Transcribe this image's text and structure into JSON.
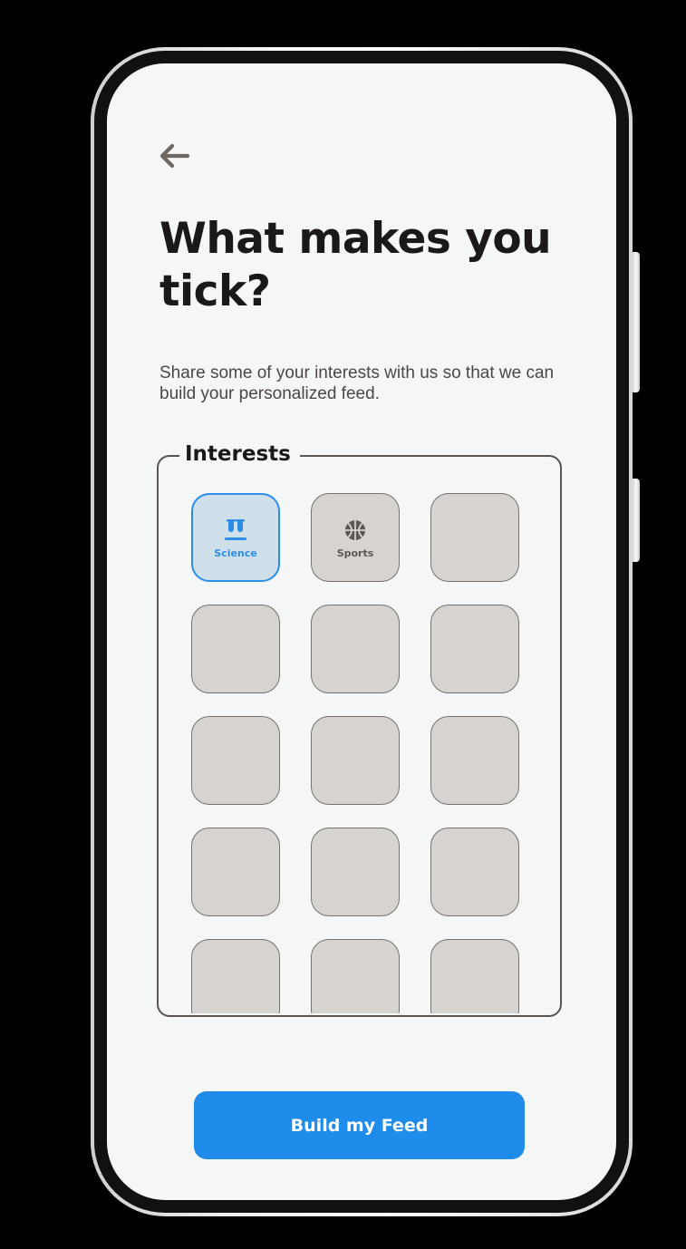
{
  "header": {
    "back_icon": "arrow-left-icon"
  },
  "page": {
    "title": "What makes you tick?",
    "subtitle": "Share some of your interests with us so that we can build your personalized feed."
  },
  "interests": {
    "legend": "Interests",
    "tiles": [
      {
        "label": "Science",
        "icon": "test-tubes-icon",
        "selected": true
      },
      {
        "label": "Sports",
        "icon": "basketball-icon",
        "selected": false
      },
      {
        "label": "",
        "icon": "",
        "selected": false
      },
      {
        "label": "",
        "icon": "",
        "selected": false
      },
      {
        "label": "",
        "icon": "",
        "selected": false
      },
      {
        "label": "",
        "icon": "",
        "selected": false
      },
      {
        "label": "",
        "icon": "",
        "selected": false
      },
      {
        "label": "",
        "icon": "",
        "selected": false
      },
      {
        "label": "",
        "icon": "",
        "selected": false
      },
      {
        "label": "",
        "icon": "",
        "selected": false
      },
      {
        "label": "",
        "icon": "",
        "selected": false
      },
      {
        "label": "",
        "icon": "",
        "selected": false
      },
      {
        "label": "",
        "icon": "",
        "selected": false
      },
      {
        "label": "",
        "icon": "",
        "selected": false
      },
      {
        "label": "",
        "icon": "",
        "selected": false
      }
    ]
  },
  "cta": {
    "label": "Build my Feed"
  },
  "colors": {
    "accent": "#1f8bea",
    "selected_tile_bg": "#cfe0ea",
    "tile_bg": "#d7d3d1",
    "screen_bg": "#f5f6f6",
    "text_primary": "#1b1918"
  }
}
